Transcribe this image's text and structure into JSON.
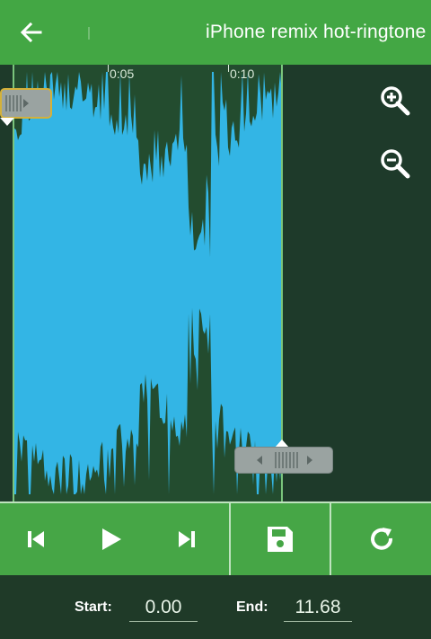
{
  "app_bar": {
    "title": "iPhone remix hot-ringtone",
    "background": "#43a744",
    "back_icon": "arrow-left-icon"
  },
  "waveform": {
    "time_markers": [
      "0:05",
      "0:10"
    ],
    "wave_color": "#33b5e5",
    "selection_color": "#234c2f",
    "background": "#1e3a2a"
  },
  "zoom": {
    "zoom_in_icon": "zoom-in-icon",
    "zoom_out_icon": "zoom-out-icon"
  },
  "controls": {
    "icons": [
      "skip-previous-icon",
      "play-icon",
      "skip-next-icon",
      "save-icon",
      "reset-icon"
    ],
    "background": "#46a646"
  },
  "footer": {
    "start_label": "Start:",
    "start_value": "0.00",
    "end_label": "End:",
    "end_value": "11.68"
  }
}
